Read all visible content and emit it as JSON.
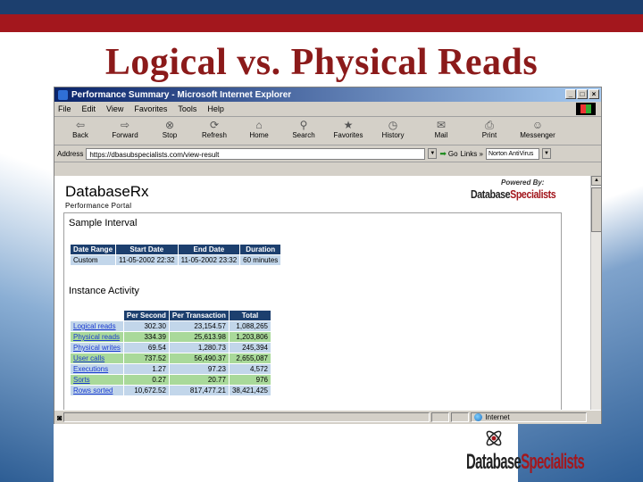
{
  "slide": {
    "title": "Logical vs. Physical Reads"
  },
  "window": {
    "title": "Performance Summary - Microsoft Internet Explorer",
    "controls": {
      "minimize": "_",
      "maximize": "□",
      "close": "×"
    }
  },
  "menu": [
    "File",
    "Edit",
    "View",
    "Favorites",
    "Tools",
    "Help"
  ],
  "toolbar": [
    {
      "label": "Back",
      "icon": "back-arrow-icon"
    },
    {
      "label": "Forward",
      "icon": "forward-arrow-icon"
    },
    {
      "label": "Stop",
      "icon": "stop-icon"
    },
    {
      "label": "Refresh",
      "icon": "refresh-icon"
    },
    {
      "label": "Home",
      "icon": "home-icon"
    },
    {
      "label": "Search",
      "icon": "search-icon"
    },
    {
      "label": "Favorites",
      "icon": "favorites-icon"
    },
    {
      "label": "History",
      "icon": "history-icon"
    },
    {
      "label": "Mail",
      "icon": "mail-icon"
    },
    {
      "label": "Print",
      "icon": "print-icon"
    },
    {
      "label": "Messenger",
      "icon": "messenger-icon"
    }
  ],
  "address": {
    "label": "Address",
    "url": "https://dbasubspecialists.com/view-result",
    "go": "Go",
    "links": "Links »",
    "norton": "Norton AntiVirus"
  },
  "page": {
    "brand": "Database",
    "brand_suffix": "Rx",
    "brand_sub": "Performance Portal",
    "powered_by": "Powered By:",
    "logo_left": "Database",
    "logo_right": "Specialists"
  },
  "sample": {
    "title": "Sample Interval",
    "headers": [
      "Date Range",
      "Start Date",
      "End Date",
      "Duration"
    ],
    "row": [
      "Custom",
      "11-05-2002 22:32",
      "11-05-2002 23:32",
      "60 minutes"
    ]
  },
  "activity": {
    "title": "Instance Activity",
    "headers": [
      "",
      "Per Second",
      "Per Transaction",
      "Total"
    ],
    "rows": [
      [
        "Logical reads",
        "302.30",
        "23,154.57",
        "1,088,265"
      ],
      [
        "Physical reads",
        "334.39",
        "25,613.98",
        "1,203,806"
      ],
      [
        "Physical writes",
        "69.54",
        "1,280.73",
        "245,394"
      ],
      [
        "User calls",
        "737.52",
        "56,490.37",
        "2,655,087"
      ],
      [
        "Executions",
        "1.27",
        "97.23",
        "4,572"
      ],
      [
        "Sorts",
        "0.27",
        "20.77",
        "976"
      ],
      [
        "Rows sorted",
        "10,672.52",
        "817,477.21",
        "38,421,425"
      ]
    ]
  },
  "status": {
    "zone": "Internet"
  },
  "footer_logo": {
    "left": "Database",
    "right": "Specialists"
  }
}
